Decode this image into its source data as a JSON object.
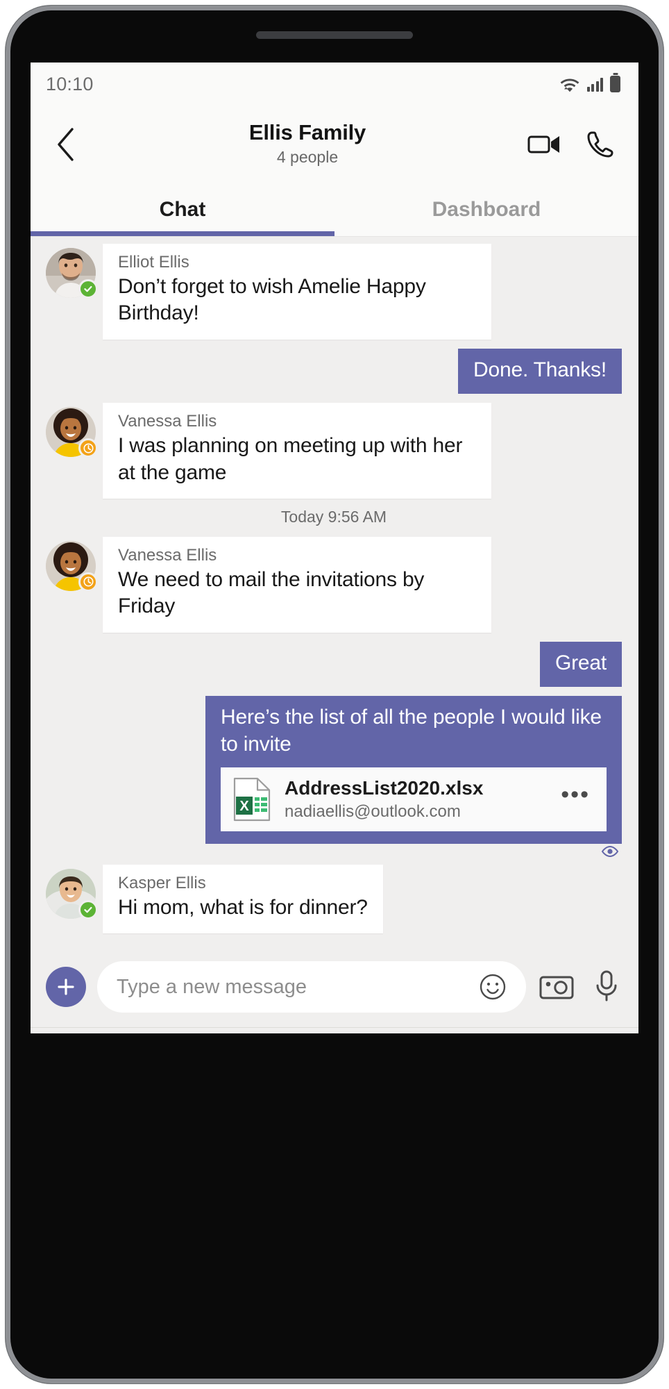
{
  "status_bar": {
    "time": "10:10",
    "icons": [
      "wifi-icon",
      "cellular-signal-icon",
      "battery-icon"
    ]
  },
  "header": {
    "back_label": "back-chevron",
    "title": "Ellis Family",
    "subtitle": "4 people",
    "video_call_label": "video-call",
    "audio_call_label": "audio-call"
  },
  "tabs": [
    {
      "label": "Chat",
      "active": true
    },
    {
      "label": "Dashboard",
      "active": false
    }
  ],
  "messages": [
    {
      "id": "m1",
      "direction": "incoming",
      "sender": "Elliot Ellis",
      "text": "Don’t forget to wish Amelie Happy Birthday!",
      "presence": "available"
    },
    {
      "id": "m2",
      "direction": "outgoing",
      "text": "Done. Thanks!"
    },
    {
      "id": "m3",
      "direction": "incoming",
      "sender": "Vanessa Ellis",
      "text": "I was planning on meeting up with her at the game",
      "presence": "away"
    },
    {
      "id": "divider1",
      "direction": "timestamp",
      "text": "Today 9:56 AM"
    },
    {
      "id": "m4",
      "direction": "incoming",
      "sender": "Vanessa Ellis",
      "text": "We need to mail the invitations by Friday",
      "presence": "away"
    },
    {
      "id": "m5",
      "direction": "outgoing",
      "text": "Great"
    },
    {
      "id": "m6",
      "direction": "outgoing",
      "text": "Here’s the list of all the people I would like to invite",
      "attachment": {
        "file_name": "AddressList2020.xlsx",
        "owner": "nadiaellis@outlook.com",
        "icon": "excel-file-icon",
        "more_label": "•••"
      },
      "seen": true
    },
    {
      "id": "m7",
      "direction": "incoming",
      "sender": "Kasper Ellis",
      "text": "Hi mom, what is for dinner?",
      "presence": "available"
    }
  ],
  "composer": {
    "add_label": "+",
    "placeholder": "Type a new message",
    "value": "",
    "emoji_label": "emoji-picker",
    "camera_label": "camera",
    "mic_label": "microphone"
  },
  "android_nav": {
    "recents_label": "recent-apps",
    "home_label": "home",
    "back_label": "back"
  },
  "colors": {
    "accent": "#6265a8",
    "available": "#5cb335",
    "away": "#f3a218",
    "chat_bg": "#f0efee",
    "header_bg": "#fafaf9"
  }
}
